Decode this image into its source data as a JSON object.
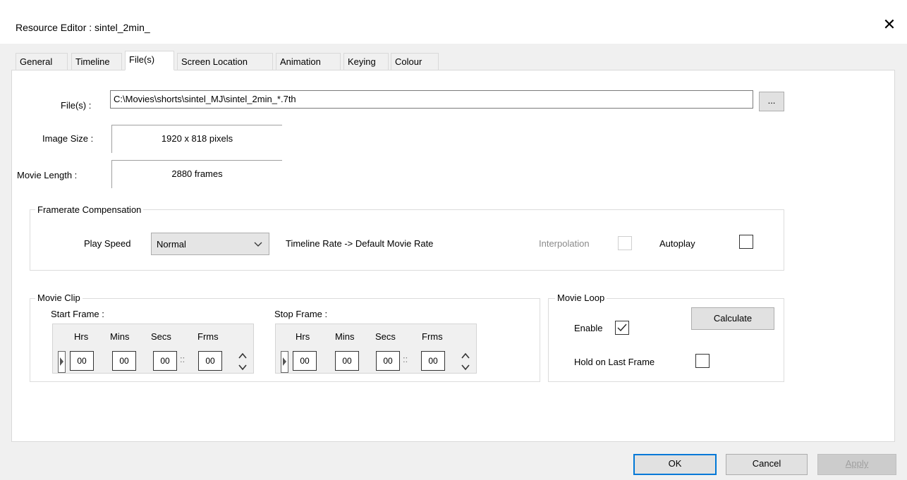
{
  "window": {
    "title": "Resource Editor  :  sintel_2min_"
  },
  "tabs": [
    {
      "label": "General"
    },
    {
      "label": "Timeline"
    },
    {
      "label": "File(s)"
    },
    {
      "label": "Screen Location"
    },
    {
      "label": "Animation"
    },
    {
      "label": "Keying"
    },
    {
      "label": "Colour"
    }
  ],
  "files": {
    "label": "File(s) :",
    "value": "C:\\Movies\\shorts\\sintel_MJ\\sintel_2min_*.7th",
    "browse_label": "..."
  },
  "image_size": {
    "label": "Image Size :",
    "value": "1920 x 818 pixels"
  },
  "movie_length": {
    "label": "Movie Length :",
    "value": "2880  frames"
  },
  "framerate": {
    "title": "Framerate Compensation",
    "play_speed_label": "Play Speed",
    "play_speed_value": "Normal",
    "rate_text": "Timeline Rate -> Default Movie Rate",
    "interpolation_label": "Interpolation",
    "autoplay_label": "Autoplay"
  },
  "movie_clip": {
    "title": "Movie Clip",
    "start_label": "Start Frame :",
    "stop_label": "Stop Frame :",
    "col_labels": [
      "Hrs",
      "Mins",
      "Secs",
      "Frms"
    ],
    "start_values": [
      "00",
      "00",
      "00",
      "00"
    ],
    "stop_values": [
      "00",
      "00",
      "00",
      "00"
    ]
  },
  "movie_loop": {
    "title": "Movie Loop",
    "enable_label": "Enable",
    "enable_checked": true,
    "calculate_label": "Calculate",
    "hold_label": "Hold on Last Frame"
  },
  "buttons": {
    "ok": "OK",
    "cancel": "Cancel",
    "apply": "Apply"
  },
  "colors": {
    "accent": "#0078d7",
    "panel": "#ffffff",
    "chrome": "#f0f0f0"
  }
}
